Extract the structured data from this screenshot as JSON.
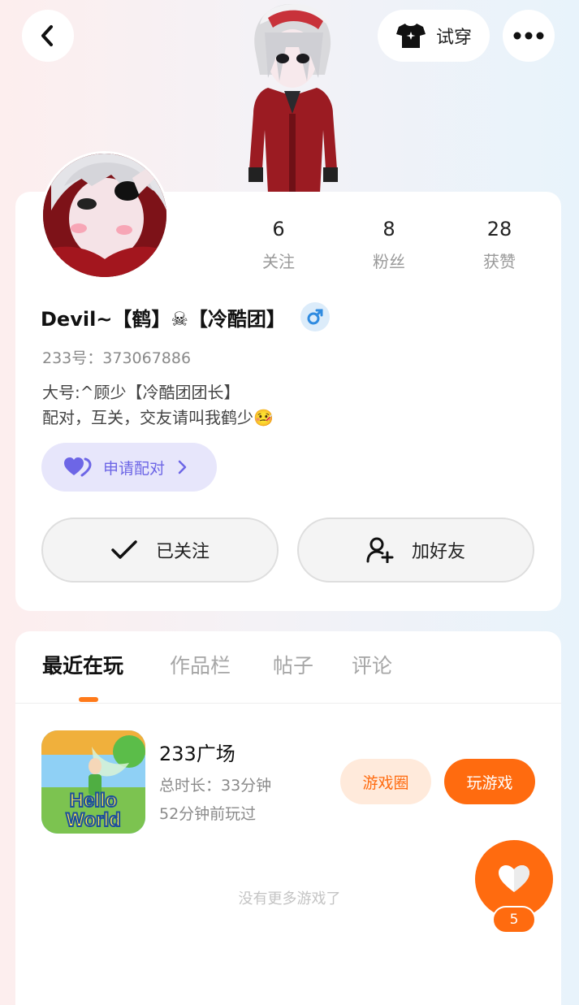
{
  "header": {
    "try_on_label": "试穿"
  },
  "stats": [
    {
      "value": "6",
      "label": "关注"
    },
    {
      "value": "8",
      "label": "粉丝"
    },
    {
      "value": "28",
      "label": "获赞"
    }
  ],
  "profile": {
    "nickname": "Devil~【鹤】☠【冷酷团】",
    "user_id": "233号：373067886",
    "bio_line1": "大号:^顾少【冷酷团团长】",
    "bio_line2": "配对，互关，交友请叫我鹤少🤒",
    "pair_label": "申请配对",
    "follow_label": "已关注",
    "add_friend_label": "加好友"
  },
  "tabs": [
    {
      "label": "最近在玩"
    },
    {
      "label": "作品栏"
    },
    {
      "label": "帖子"
    },
    {
      "label": "评论"
    }
  ],
  "games": [
    {
      "name": "233广场",
      "icon_text_1": "Hello",
      "icon_text_2": "World",
      "total_time": "总时长：33分钟",
      "last_played": "52分钟前玩过",
      "circle_label": "游戏圈",
      "play_label": "玩游戏"
    }
  ],
  "no_more_text": "没有更多游戏了",
  "like_count": "5",
  "colors": {
    "accent": "#ff6b0f",
    "pair_purple": "#6d66e6",
    "gender_blue": "#2f8be0"
  }
}
